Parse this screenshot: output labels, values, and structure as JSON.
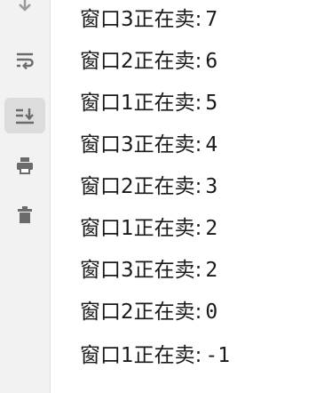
{
  "toolbar": {
    "icons": [
      "scroll-down-arrow-icon",
      "soft-wrap-icon",
      "scroll-to-end-icon",
      "print-icon",
      "clear-trash-icon"
    ],
    "active": "scroll-to-end-icon"
  },
  "console": {
    "lines": [
      {
        "label": "窗口3正在卖:",
        "value": "7"
      },
      {
        "label": "窗口2正在卖:",
        "value": "6"
      },
      {
        "label": "窗口1正在卖:",
        "value": "5"
      },
      {
        "label": "窗口3正在卖:",
        "value": "4"
      },
      {
        "label": "窗口2正在卖:",
        "value": "3"
      },
      {
        "label": "窗口1正在卖:",
        "value": "2"
      },
      {
        "label": "窗口3正在卖:",
        "value": "2"
      },
      {
        "label": "窗口2正在卖:",
        "value": "0"
      },
      {
        "label": "窗口1正在卖:",
        "value": "-1"
      }
    ]
  },
  "colors": {
    "gutter": "#f2f2f2",
    "icon": "#6b6b6b",
    "active_bg": "#dcdcdc",
    "text": "#1a1a1a"
  }
}
